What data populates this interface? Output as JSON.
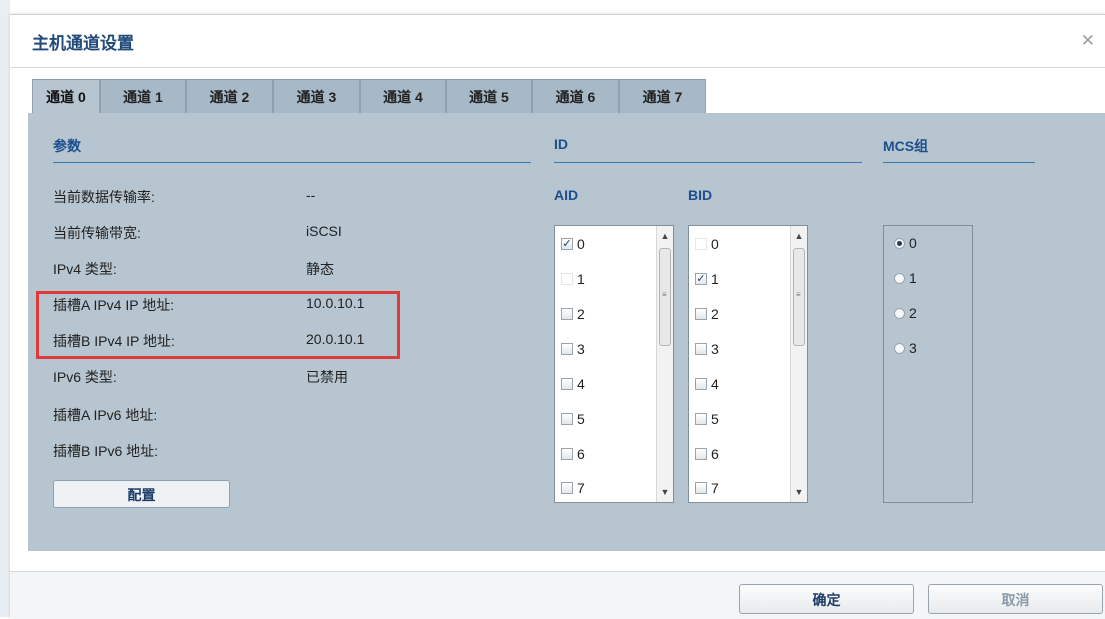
{
  "dialog": {
    "title": "主机通道设置",
    "close_icon": "close-icon"
  },
  "tabs": [
    {
      "label": "通道 0",
      "active": true
    },
    {
      "label": "通道 1"
    },
    {
      "label": "通道 2"
    },
    {
      "label": "通道 3"
    },
    {
      "label": "通道 4"
    },
    {
      "label": "通道 5"
    },
    {
      "label": "通道 6"
    },
    {
      "label": "通道 7"
    }
  ],
  "params": {
    "heading": "参数",
    "rows": [
      {
        "label": "当前数据传输率:",
        "value": "--"
      },
      {
        "label": "当前传输带宽:",
        "value": "iSCSI"
      },
      {
        "label": "IPv4 类型:",
        "value": "静态"
      },
      {
        "label": "插槽A IPv4 IP 地址:",
        "value": "10.0.10.1"
      },
      {
        "label": "插槽B IPv4 IP 地址:",
        "value": "20.0.10.1"
      },
      {
        "label": "IPv6 类型:",
        "value": "已禁用"
      },
      {
        "label": "插槽A IPv6 地址:",
        "value": ""
      },
      {
        "label": "插槽B IPv6 地址:",
        "value": ""
      }
    ],
    "config_button": "配置"
  },
  "id_section": {
    "heading": "ID",
    "aid": {
      "label": "AID",
      "items": [
        "0",
        "1",
        "2",
        "3",
        "4",
        "5",
        "6",
        "7"
      ],
      "checked": [
        "0"
      ],
      "unchecked_plain": [
        "1"
      ]
    },
    "bid": {
      "label": "BID",
      "items": [
        "0",
        "1",
        "2",
        "3",
        "4",
        "5",
        "6",
        "7"
      ],
      "checked": [
        "1"
      ],
      "unchecked_plain": [
        "0"
      ]
    }
  },
  "mcs": {
    "heading": "MCS组",
    "options": [
      "0",
      "1",
      "2",
      "3"
    ],
    "selected": "0"
  },
  "footer": {
    "ok": "确定",
    "cancel": "取消"
  },
  "colors": {
    "panel": "#b6c5d0",
    "heading": "#1d4f8f",
    "highlight": "#e03a3a"
  }
}
